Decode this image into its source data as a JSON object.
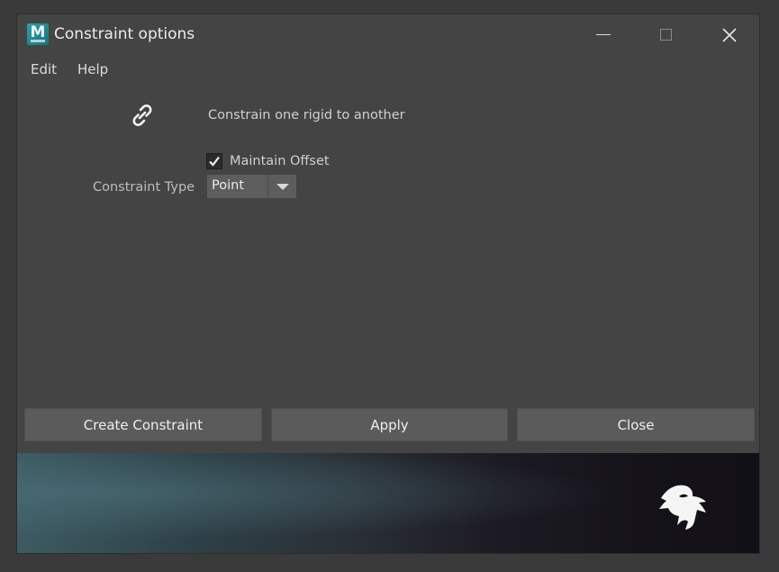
{
  "window": {
    "title": "Constraint options",
    "app_icon_letter": "M"
  },
  "menu": {
    "items": [
      "Edit",
      "Help"
    ]
  },
  "main": {
    "description": "Constrain one rigid to another",
    "maintain_offset_label": "Maintain Offset",
    "maintain_offset_checked": true,
    "constraint_type_label": "Constraint Type",
    "constraint_type_value": "Point"
  },
  "buttons": {
    "create": "Create Constraint",
    "apply": "Apply",
    "close": "Close"
  },
  "icons": {
    "link": "link-icon",
    "logo": "bifrost-logo-icon"
  },
  "colors": {
    "background": "#444444",
    "button": "#5b5b5b",
    "accent": "#2f9fa8"
  }
}
